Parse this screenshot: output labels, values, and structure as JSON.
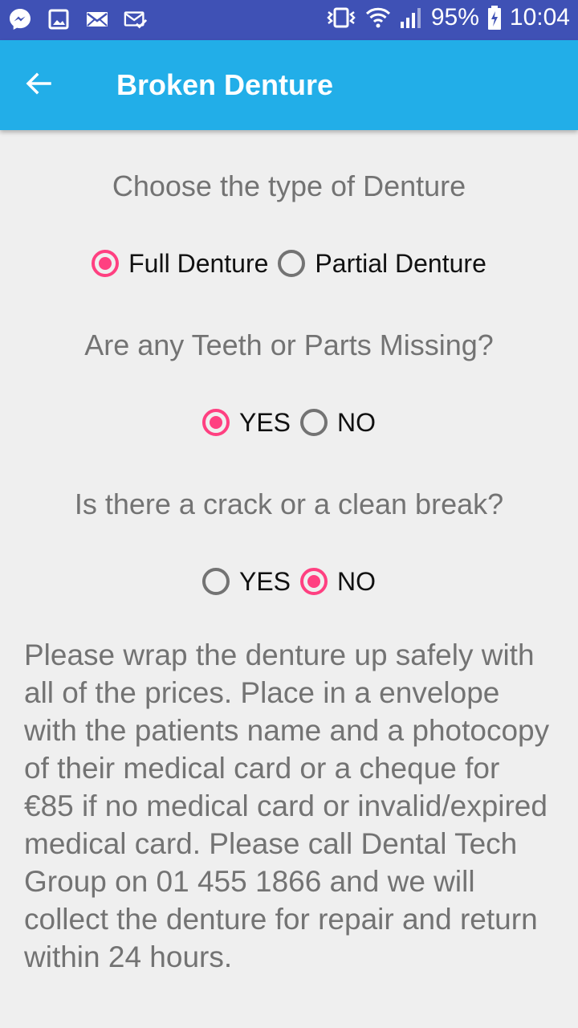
{
  "status_bar": {
    "battery": "95%",
    "time": "10:04",
    "icons": [
      "messenger-icon",
      "gallery-icon",
      "email-icon",
      "mail-check-icon",
      "vibrate-icon",
      "wifi-icon",
      "signal-icon",
      "battery-charging-icon"
    ]
  },
  "app_bar": {
    "title": "Broken Denture",
    "back_icon": "arrow-back-icon"
  },
  "questions": [
    {
      "label": "Choose the type of Denture",
      "options": [
        {
          "label": "Full Denture",
          "checked": true
        },
        {
          "label": "Partial Denture",
          "checked": false
        }
      ]
    },
    {
      "label": "Are any Teeth or Parts Missing?",
      "options": [
        {
          "label": "YES",
          "checked": true
        },
        {
          "label": "NO",
          "checked": false
        }
      ]
    },
    {
      "label": "Is there a crack or a clean break?",
      "options": [
        {
          "label": "YES",
          "checked": false
        },
        {
          "label": "NO",
          "checked": true
        }
      ]
    }
  ],
  "info_text": "Please wrap the denture up safely with all of the prices. Place in a envelope with the patients name and a photocopy of their medical card or a cheque for €85 if no medical card or invalid/expired medical card. Please call Dental Tech Group on 01 455 1866 and we will collect the denture for repair and return within 24 hours.",
  "colors": {
    "status_bar": "#3f51b5",
    "app_bar": "#22aee8",
    "accent": "#ff4081",
    "background": "#efefef",
    "text_secondary": "#737373"
  }
}
